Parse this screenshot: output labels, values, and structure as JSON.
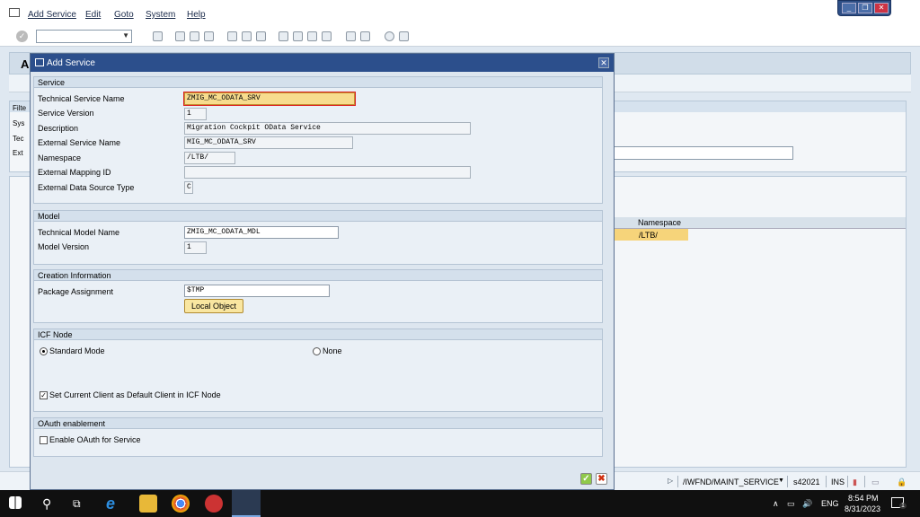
{
  "menu": {
    "items": [
      "Add Service",
      "Edit",
      "Goto",
      "System",
      "Help"
    ]
  },
  "window_controls": {
    "minimize": "_",
    "restore": "❐",
    "close": "✕"
  },
  "background": {
    "title_char": "A",
    "panel_label": "Filte",
    "row_labels": [
      "Sys",
      "Tec",
      "Ext"
    ],
    "grid_column": "Namespace",
    "grid_value": "/LTB/"
  },
  "dialog": {
    "title": "Add Service",
    "close": "✕",
    "service": {
      "heading": "Service",
      "technical_service_name_label": "Technical Service Name",
      "technical_service_name": "ZMIG_MC_ODATA_SRV",
      "service_version_label": "Service Version",
      "service_version": "1",
      "description_label": "Description",
      "description": "Migration Cockpit OData Service",
      "external_service_name_label": "External Service Name",
      "external_service_name": "MIG_MC_ODATA_SRV",
      "namespace_label": "Namespace",
      "namespace": "/LTB/",
      "external_mapping_id_label": "External Mapping ID",
      "external_mapping_id": "",
      "external_data_source_type_label": "External Data Source Type",
      "external_data_source_type": "C"
    },
    "model": {
      "heading": "Model",
      "technical_model_name_label": "Technical Model Name",
      "technical_model_name": "ZMIG_MC_ODATA_MDL",
      "model_version_label": "Model Version",
      "model_version": "1"
    },
    "creation": {
      "heading": "Creation Information",
      "package_assignment_label": "Package Assignment",
      "package_assignment": "$TMP",
      "local_object_button": "Local Object"
    },
    "icf": {
      "heading": "ICF Node",
      "standard_mode_label": "Standard Mode",
      "standard_mode_selected": true,
      "none_label": "None",
      "default_client_label": "Set Current Client as Default Client in ICF Node",
      "default_client_checked": true,
      "check_mark": "✓"
    },
    "oauth": {
      "heading": "OAuth enablement",
      "enable_label": "Enable OAuth for Service",
      "enable_checked": false
    },
    "footer": {
      "ok": "✓",
      "cancel": "✖"
    }
  },
  "status": {
    "transaction": "/IWFND/MAINT_SERVICE",
    "system": "s42021",
    "mode": "INS"
  },
  "taskbar": {
    "ime": "ENG",
    "time": "8:54 PM",
    "date": "8/31/2023",
    "notification_count": "1"
  }
}
